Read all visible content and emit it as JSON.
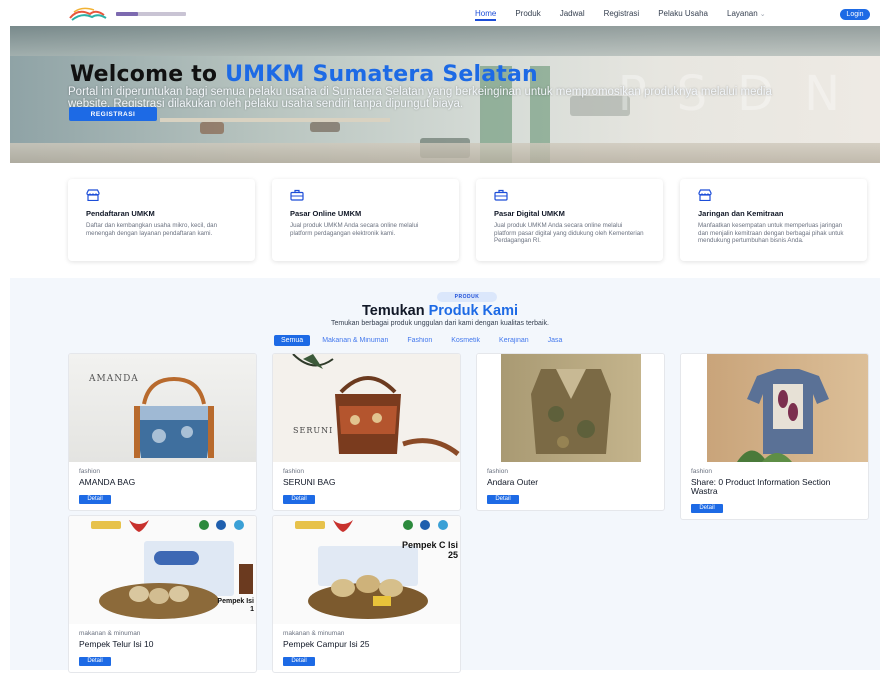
{
  "nav": {
    "links": [
      "Home",
      "Produk",
      "Jadwal",
      "Registrasi",
      "Pelaku Usaha",
      "Layanan"
    ],
    "login": "Login"
  },
  "hero": {
    "title_prefix": "Welcome to ",
    "title_highlight": "UMKM Sumatera Selatan",
    "subtitle": "Portal ini diperuntukan bagi semua pelaku usaha di Sumatera Selatan yang berkeinginan untuk mempromosikan produknya melalui media website. Registrasi dilakukan oleh pelaku usaha sendiri tanpa dipungut biaya.",
    "button": "REGISTRASI"
  },
  "features": [
    {
      "icon": "store-icon",
      "title": "Pendaftaran UMKM",
      "desc": "Daftar dan kembangkan usaha mikro, kecil, dan menengah dengan layanan pendaftaran kami."
    },
    {
      "icon": "briefcase-icon",
      "title": "Pasar Online UMKM",
      "desc": "Jual produk UMKM Anda secara online melalui platform perdagangan elektronik kami."
    },
    {
      "icon": "briefcase-icon",
      "title": "Pasar Digital UMKM",
      "desc": "Jual produk UMKM Anda secara online melalui platform pasar digital yang didukung oleh Kementerian Perdagangan RI."
    },
    {
      "icon": "store-icon",
      "title": "Jaringan dan Kemitraan",
      "desc": "Manfaatkan kesempatan untuk memperluas jaringan dan menjalin kemitraan dengan berbagai pihak untuk mendukung pertumbuhan bisnis Anda."
    }
  ],
  "products_section": {
    "badge": "PRODUK",
    "title_prefix": "Temukan ",
    "title_highlight": "Produk Kami",
    "subtitle": "Temukan berbagai produk unggulan dari kami dengan kualitas terbaik.",
    "filters": [
      "Semua",
      "Makanan & Minuman",
      "Fashion",
      "Kosmetik",
      "Kerajinan",
      "Jasa"
    ],
    "detail_label": "Detail",
    "items": [
      {
        "category": "fashion",
        "name": "AMANDA BAG",
        "image_text": "AMANDA"
      },
      {
        "category": "fashion",
        "name": "SERUNI BAG",
        "image_text": "SERUNI"
      },
      {
        "category": "fashion",
        "name": "Andara Outer",
        "image_text": ""
      },
      {
        "category": "fashion",
        "name": "Share: 0 Product Information Section Wastra",
        "image_text": ""
      },
      {
        "category": "makanan & minuman",
        "name": "Pempek Telur Isi 10",
        "image_text": "Pempek Isi 1"
      },
      {
        "category": "makanan & minuman",
        "name": "Pempek Campur Isi 25",
        "image_text": "Pempek C Isi 25"
      }
    ]
  },
  "colors": {
    "accent": "#1d6ae5",
    "section_bg": "#f3f7fc"
  }
}
